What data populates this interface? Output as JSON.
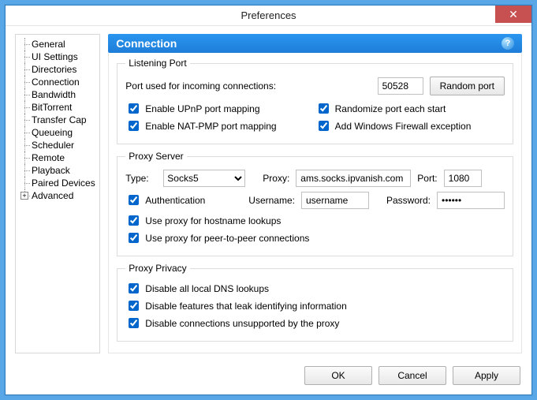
{
  "window": {
    "title": "Preferences"
  },
  "sidebar": {
    "items": [
      "General",
      "UI Settings",
      "Directories",
      "Connection",
      "Bandwidth",
      "BitTorrent",
      "Transfer Cap",
      "Queueing",
      "Scheduler",
      "Remote",
      "Playback",
      "Paired Devices",
      "Advanced"
    ],
    "selected": 3,
    "expandable": 12
  },
  "panel": {
    "title": "Connection",
    "listening": {
      "legend": "Listening Port",
      "port_label": "Port used for incoming connections:",
      "port_value": "50528",
      "random_btn": "Random port",
      "upnp": "Enable UPnP port mapping",
      "natpmp": "Enable NAT-PMP port mapping",
      "randomize": "Randomize port each start",
      "firewall": "Add Windows Firewall exception"
    },
    "proxy": {
      "legend": "Proxy Server",
      "type_label": "Type:",
      "type_value": "Socks5",
      "proxy_label": "Proxy:",
      "proxy_value": "ams.socks.ipvanish.com",
      "port_label": "Port:",
      "port_value": "1080",
      "auth": "Authentication",
      "user_label": "Username:",
      "user_value": "username",
      "pass_label": "Password:",
      "pass_value": "secret",
      "hostname": "Use proxy for hostname lookups",
      "p2p": "Use proxy for peer-to-peer connections"
    },
    "privacy": {
      "legend": "Proxy Privacy",
      "dns": "Disable all local DNS lookups",
      "leak": "Disable features that leak identifying information",
      "unsup": "Disable connections unsupported by the proxy"
    }
  },
  "footer": {
    "ok": "OK",
    "cancel": "Cancel",
    "apply": "Apply"
  }
}
